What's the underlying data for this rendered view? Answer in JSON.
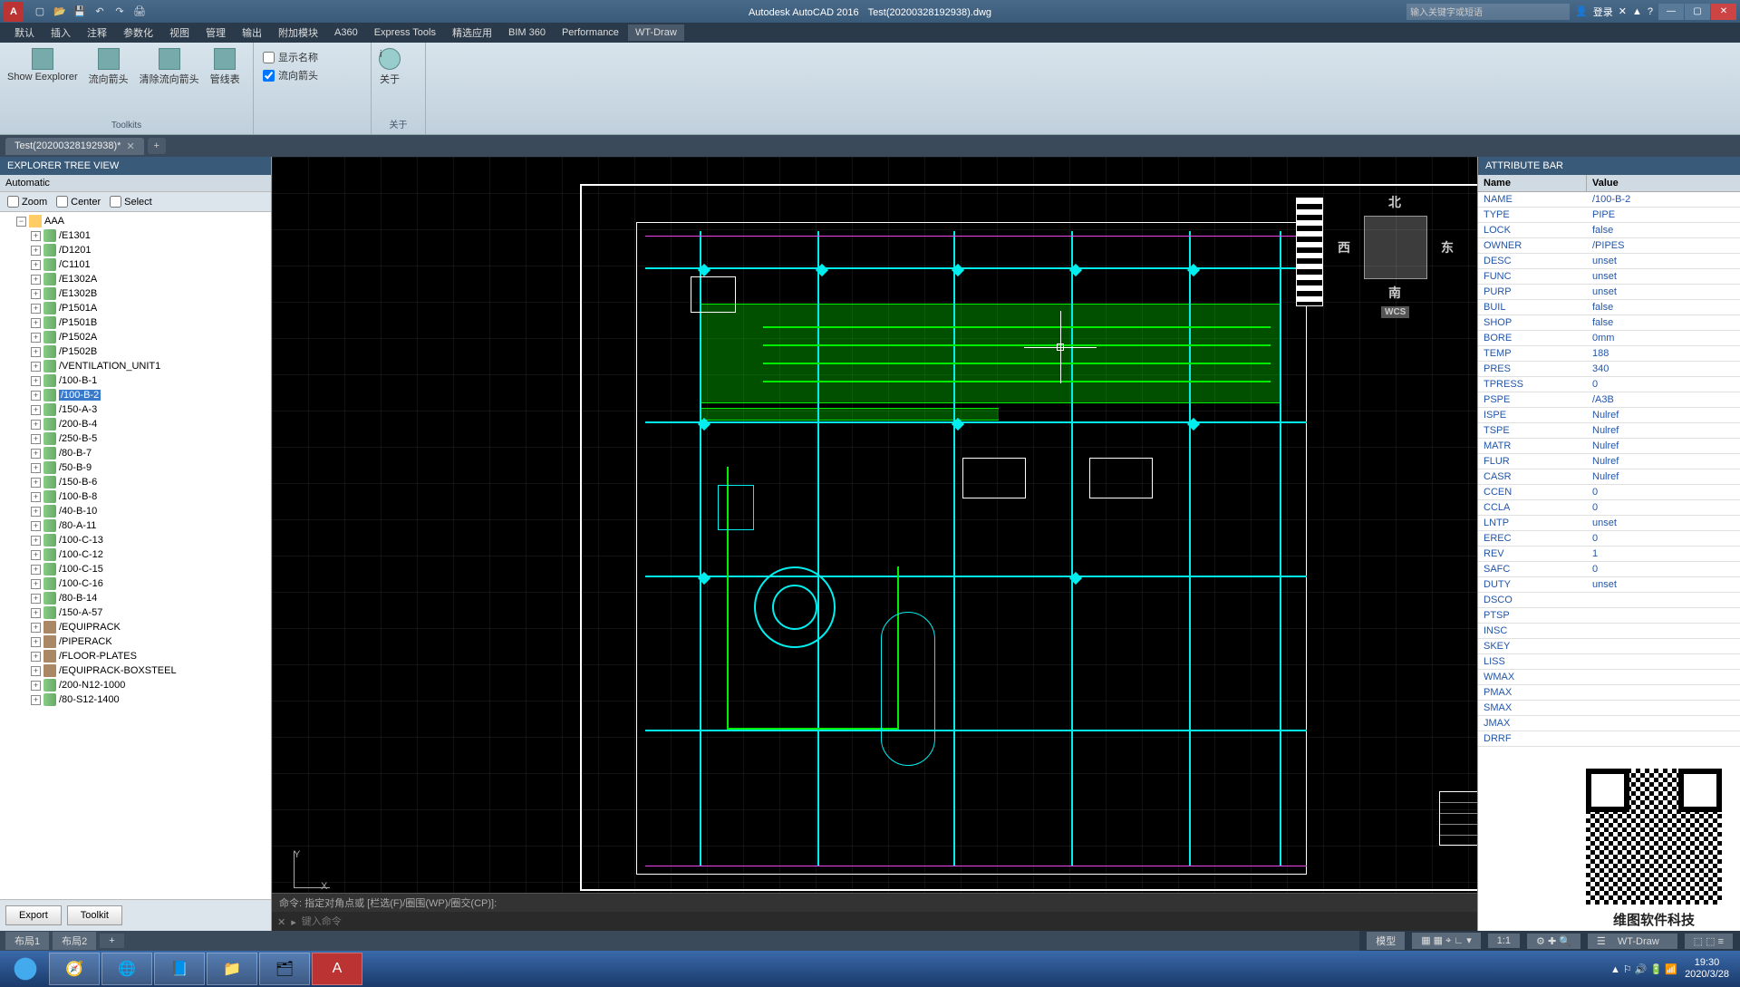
{
  "title": {
    "app": "Autodesk AutoCAD 2016",
    "file": "Test(20200328192938).dwg"
  },
  "titlebar": {
    "search_ph": "输入关键字或短语",
    "login": "登录"
  },
  "menu": [
    "默认",
    "插入",
    "注释",
    "参数化",
    "视图",
    "管理",
    "输出",
    "附加模块",
    "A360",
    "Express Tools",
    "精选应用",
    "BIM 360",
    "Performance",
    "WT-Draw"
  ],
  "menu_active": 13,
  "ribbon": {
    "items": [
      {
        "label": "Show Eexplorer"
      },
      {
        "label": "流向箭头"
      },
      {
        "label": "清除流向箭头"
      },
      {
        "label": "管线表"
      }
    ],
    "checks": [
      {
        "label": "显示名称",
        "checked": false
      },
      {
        "label": "流向箭头",
        "checked": true
      }
    ],
    "groups": [
      "Toolkits",
      "关于"
    ],
    "about": "关于"
  },
  "tab": {
    "name": "Test(20200328192938)*"
  },
  "explorer": {
    "title": "EXPLORER TREE VIEW",
    "mode": "Automatic",
    "opts": [
      "Zoom",
      "Center",
      "Select"
    ],
    "root": "AAA",
    "nodes": [
      {
        "t": "/E1301",
        "i": "pipe"
      },
      {
        "t": "/D1201",
        "i": "pipe"
      },
      {
        "t": "/C1101",
        "i": "pipe"
      },
      {
        "t": "/E1302A",
        "i": "pipe"
      },
      {
        "t": "/E1302B",
        "i": "pipe"
      },
      {
        "t": "/P1501A",
        "i": "pipe"
      },
      {
        "t": "/P1501B",
        "i": "pipe"
      },
      {
        "t": "/P1502A",
        "i": "pipe"
      },
      {
        "t": "/P1502B",
        "i": "pipe"
      },
      {
        "t": "/VENTILATION_UNIT1",
        "i": "pipe"
      },
      {
        "t": "/100-B-1",
        "i": "pipe"
      },
      {
        "t": "/100-B-2",
        "i": "pipe",
        "sel": true
      },
      {
        "t": "/150-A-3",
        "i": "pipe"
      },
      {
        "t": "/200-B-4",
        "i": "pipe"
      },
      {
        "t": "/250-B-5",
        "i": "pipe"
      },
      {
        "t": "/80-B-7",
        "i": "pipe"
      },
      {
        "t": "/50-B-9",
        "i": "pipe"
      },
      {
        "t": "/150-B-6",
        "i": "pipe"
      },
      {
        "t": "/100-B-8",
        "i": "pipe"
      },
      {
        "t": "/40-B-10",
        "i": "pipe"
      },
      {
        "t": "/80-A-11",
        "i": "pipe"
      },
      {
        "t": "/100-C-13",
        "i": "pipe"
      },
      {
        "t": "/100-C-12",
        "i": "pipe"
      },
      {
        "t": "/100-C-15",
        "i": "pipe"
      },
      {
        "t": "/100-C-16",
        "i": "pipe"
      },
      {
        "t": "/80-B-14",
        "i": "pipe"
      },
      {
        "t": "/150-A-57",
        "i": "pipe"
      },
      {
        "t": "/EQUIPRACK",
        "i": "rack"
      },
      {
        "t": "/PIPERACK",
        "i": "rack"
      },
      {
        "t": "/FLOOR-PLATES",
        "i": "rack"
      },
      {
        "t": "/EQUIPRACK-BOXSTEEL",
        "i": "rack"
      },
      {
        "t": "/200-N12-1000",
        "i": "pipe"
      },
      {
        "t": "/80-S12-1400",
        "i": "pipe"
      }
    ],
    "btns": [
      "Export",
      "Toolkit"
    ]
  },
  "attr": {
    "title": "ATTRIBUTE BAR",
    "head": {
      "n": "Name",
      "v": "Value"
    },
    "rows": [
      {
        "n": "NAME",
        "v": "/100-B-2"
      },
      {
        "n": "TYPE",
        "v": "PIPE"
      },
      {
        "n": "LOCK",
        "v": "false"
      },
      {
        "n": "OWNER",
        "v": "/PIPES"
      },
      {
        "n": "DESC",
        "v": "unset"
      },
      {
        "n": "FUNC",
        "v": "unset"
      },
      {
        "n": "PURP",
        "v": "unset"
      },
      {
        "n": "BUIL",
        "v": "false"
      },
      {
        "n": "SHOP",
        "v": "false"
      },
      {
        "n": "BORE",
        "v": "0mm"
      },
      {
        "n": "TEMP",
        "v": "188"
      },
      {
        "n": "PRES",
        "v": "340"
      },
      {
        "n": "TPRESS",
        "v": "0"
      },
      {
        "n": "PSPE",
        "v": "/A3B"
      },
      {
        "n": "ISPE",
        "v": "Nulref"
      },
      {
        "n": "TSPE",
        "v": "Nulref"
      },
      {
        "n": "MATR",
        "v": "Nulref"
      },
      {
        "n": "FLUR",
        "v": "Nulref"
      },
      {
        "n": "CASR",
        "v": "Nulref"
      },
      {
        "n": "CCEN",
        "v": "0"
      },
      {
        "n": "CCLA",
        "v": "0"
      },
      {
        "n": "LNTP",
        "v": "unset"
      },
      {
        "n": "EREC",
        "v": "0"
      },
      {
        "n": "REV",
        "v": "1"
      },
      {
        "n": "SAFC",
        "v": "0"
      },
      {
        "n": "DUTY",
        "v": "unset"
      },
      {
        "n": "DSCO",
        "v": ""
      },
      {
        "n": "PTSP",
        "v": ""
      },
      {
        "n": "INSC",
        "v": ""
      },
      {
        "n": "SKEY",
        "v": ""
      },
      {
        "n": "LISS",
        "v": ""
      },
      {
        "n": "WMAX",
        "v": ""
      },
      {
        "n": "PMAX",
        "v": ""
      },
      {
        "n": "SMAX",
        "v": ""
      },
      {
        "n": "JMAX",
        "v": ""
      },
      {
        "n": "DRRF",
        "v": ""
      }
    ]
  },
  "qr": {
    "label": "维图软件科技"
  },
  "cmd": {
    "hist": "命令: 指定对角点或 [栏选(F)/圈围(WP)/圈交(CP)]:",
    "ph": "键入命令"
  },
  "nav": {
    "n": "北",
    "s": "南",
    "e": "东",
    "w": "西",
    "wcs": "WCS"
  },
  "layout": [
    "布局1",
    "布局2"
  ],
  "status": {
    "model": "模型",
    "ratio": "1:1",
    "ws": "WT-Draw"
  },
  "clock": {
    "time": "19:30",
    "date": "2020/3/28"
  }
}
